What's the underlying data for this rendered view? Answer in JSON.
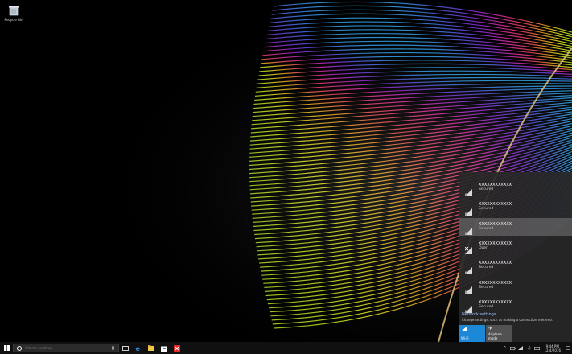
{
  "desktop": {
    "icons": [
      {
        "label": "Recycle Bin"
      }
    ]
  },
  "wifi_panel": {
    "networks": [
      {
        "name": "XXXXXXXXXXXX",
        "status": "Secured",
        "selected": false,
        "icon": "wifi-signal-icon"
      },
      {
        "name": "XXXXXXXXXXXX",
        "status": "Secured",
        "selected": false,
        "icon": "wifi-signal-icon"
      },
      {
        "name": "XXXXXXXXXXXX",
        "status": "Secured",
        "selected": true,
        "icon": "wifi-signal-icon"
      },
      {
        "name": "XXXXXXXXXXXX",
        "status": "Open",
        "selected": false,
        "icon": "wifi-open-icon"
      },
      {
        "name": "XXXXXXXXXXXX",
        "status": "Secured",
        "selected": false,
        "icon": "wifi-signal-icon"
      },
      {
        "name": "XXXXXXXXXXXX",
        "status": "Secured",
        "selected": false,
        "icon": "wifi-signal-icon"
      },
      {
        "name": "XXXXXXXXXXXX",
        "status": "Secured",
        "selected": false,
        "icon": "wifi-signal-icon"
      }
    ],
    "settings_link": "Network settings",
    "settings_sub": "Change settings, such as making a connection metered.",
    "tiles": {
      "wifi": "Wi-Fi",
      "airplane": "Airplane mode"
    }
  },
  "taskbar": {
    "search_placeholder": "Ask me anything",
    "apps": [
      "task-view-icon",
      "edge-icon",
      "file-explorer-icon",
      "store-icon",
      "red-app-icon"
    ],
    "clock_time": "9:44 PM",
    "clock_date": "12/4/2016"
  },
  "colors": {
    "accent": "#1e88d8",
    "panel_bg": "#282828",
    "taskbar_bg": "#101010"
  }
}
